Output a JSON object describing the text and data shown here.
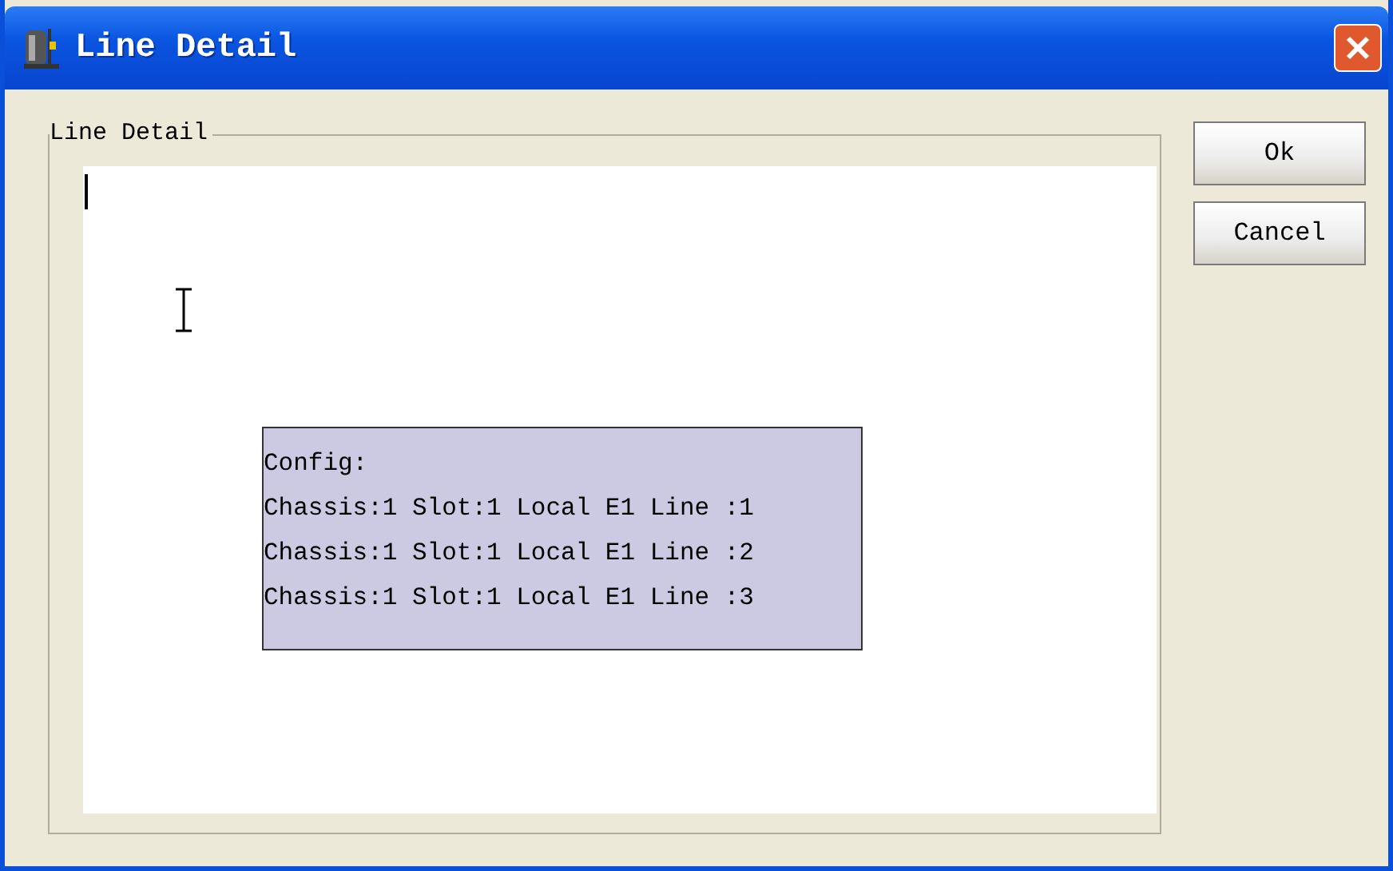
{
  "window": {
    "title": "Line Detail"
  },
  "group": {
    "label": "Line Detail"
  },
  "tooltip": {
    "heading": "Config:",
    "lines": [
      "Chassis:1 Slot:1 Local E1 Line :1",
      "Chassis:1 Slot:1 Local E1 Line :2",
      "Chassis:1 Slot:1 Local E1 Line :3"
    ]
  },
  "buttons": [
    "Ok",
    "Cancel"
  ]
}
